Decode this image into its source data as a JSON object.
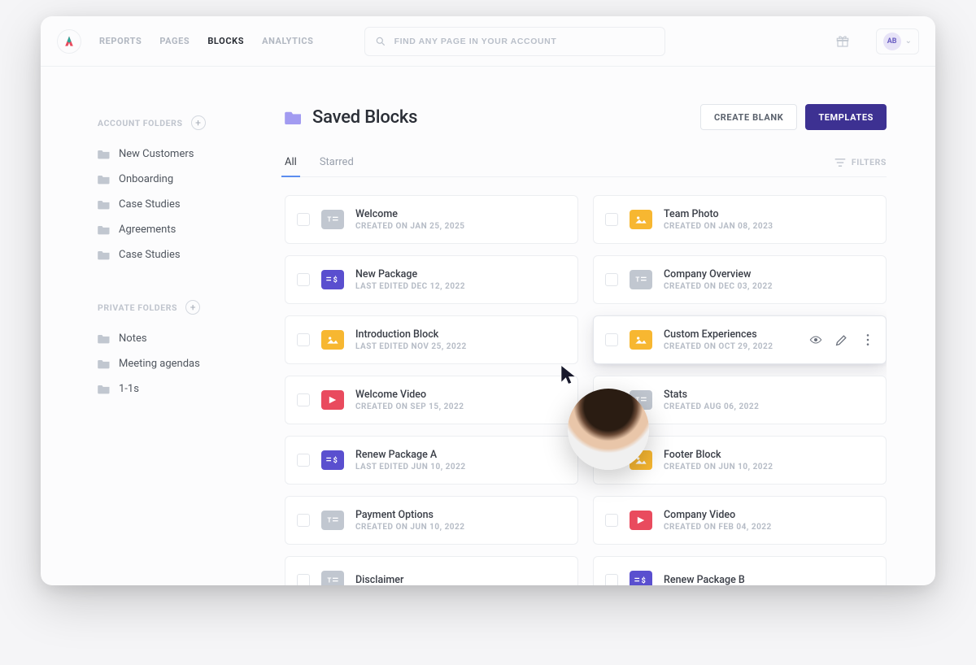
{
  "nav": {
    "items": [
      "REPORTS",
      "PAGES",
      "BLOCKS",
      "ANALYTICS"
    ],
    "active_index": 2
  },
  "search": {
    "placeholder": "FIND ANY PAGE IN YOUR ACCOUNT"
  },
  "avatar": {
    "initials": "AB"
  },
  "sidebar": {
    "account_label": "ACCOUNT FOLDERS",
    "private_label": "PRIVATE FOLDERS",
    "account_items": [
      "New Customers",
      "Onboarding",
      "Case Studies",
      "Agreements",
      "Case Studies"
    ],
    "private_items": [
      "Notes",
      "Meeting agendas",
      "1-1s"
    ]
  },
  "page": {
    "title": "Saved Blocks",
    "create_blank": "CREATE BLANK",
    "templates": "TEMPLATES"
  },
  "tabs": {
    "all": "All",
    "starred": "Starred",
    "filters": "FILTERS",
    "active_index": 0
  },
  "blocks_left": [
    {
      "icon": "text",
      "title": "Welcome",
      "meta": "CREATED ON JAN 25, 2025"
    },
    {
      "icon": "price",
      "title": "New Package",
      "meta": "LAST EDITED DEC 12, 2022"
    },
    {
      "icon": "image",
      "title": "Introduction Block",
      "meta": "LAST EDITED NOV 25, 2022"
    },
    {
      "icon": "video",
      "title": "Welcome Video",
      "meta": "CREATED ON SEP 15, 2022"
    },
    {
      "icon": "price",
      "title": "Renew Package A",
      "meta": "LAST EDITED JUN 10, 2022"
    },
    {
      "icon": "text",
      "title": "Payment Options",
      "meta": "CREATED ON JUN 10, 2022"
    },
    {
      "icon": "text",
      "title": "Disclaimer",
      "meta": ""
    }
  ],
  "blocks_right": [
    {
      "icon": "image",
      "title": "Team Photo",
      "meta": "CREATED ON JAN 08, 2023"
    },
    {
      "icon": "text",
      "title": "Company Overview",
      "meta": "CREATED ON DEC 03, 2022"
    },
    {
      "icon": "image",
      "title": "Custom Experiences",
      "meta": "CREATED ON OCT 29, 2022",
      "hover": true
    },
    {
      "icon": "text",
      "title": "Stats",
      "meta": "CREATED AUG 06, 2022"
    },
    {
      "icon": "image",
      "title": "Footer Block",
      "meta": "CREATED ON JUN 10, 2022"
    },
    {
      "icon": "video",
      "title": "Company Video",
      "meta": "CREATED ON FEB 04, 2022"
    },
    {
      "icon": "price",
      "title": "Renew Package B",
      "meta": ""
    }
  ]
}
